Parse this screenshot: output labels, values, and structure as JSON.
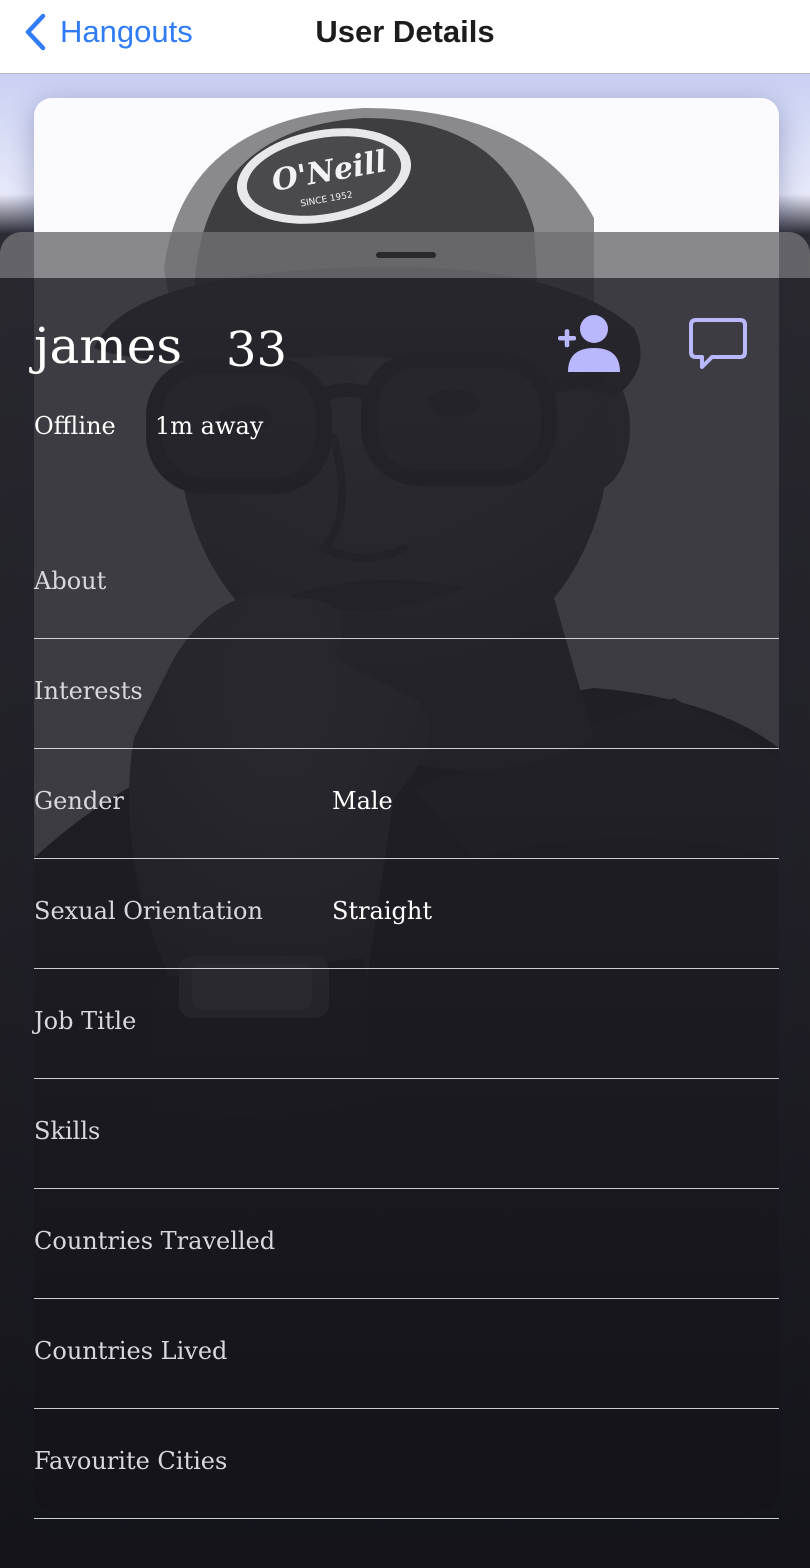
{
  "nav": {
    "back_label": "Hangouts",
    "title": "User Details",
    "back_icon": "chevron-left-icon"
  },
  "profile": {
    "name": "james",
    "age": "33",
    "status": "Offline",
    "distance": "1m away",
    "photo_description": "profile-photo",
    "cap_logo_text": "O'Neill",
    "cap_logo_subtext": "SINCE 1952"
  },
  "actions": {
    "add_friend_icon": "add-friend-icon",
    "message_icon": "chat-bubble-icon",
    "accent_color": "#b9b8ff"
  },
  "details": [
    {
      "label": "About",
      "value": ""
    },
    {
      "label": "Interests",
      "value": ""
    },
    {
      "label": "Gender",
      "value": "Male"
    },
    {
      "label": "Sexual Orientation",
      "value": "Straight"
    },
    {
      "label": "Job Title",
      "value": ""
    },
    {
      "label": "Skills",
      "value": ""
    },
    {
      "label": "Countries Travelled",
      "value": ""
    },
    {
      "label": "Countries Lived",
      "value": ""
    },
    {
      "label": "Favourite Cities",
      "value": ""
    }
  ],
  "colors": {
    "nav_tint": "#2f7cf6",
    "nav_title": "#1c1c1e",
    "sheet_handle": "#2a2a2e",
    "text_primary": "#ffffff"
  }
}
